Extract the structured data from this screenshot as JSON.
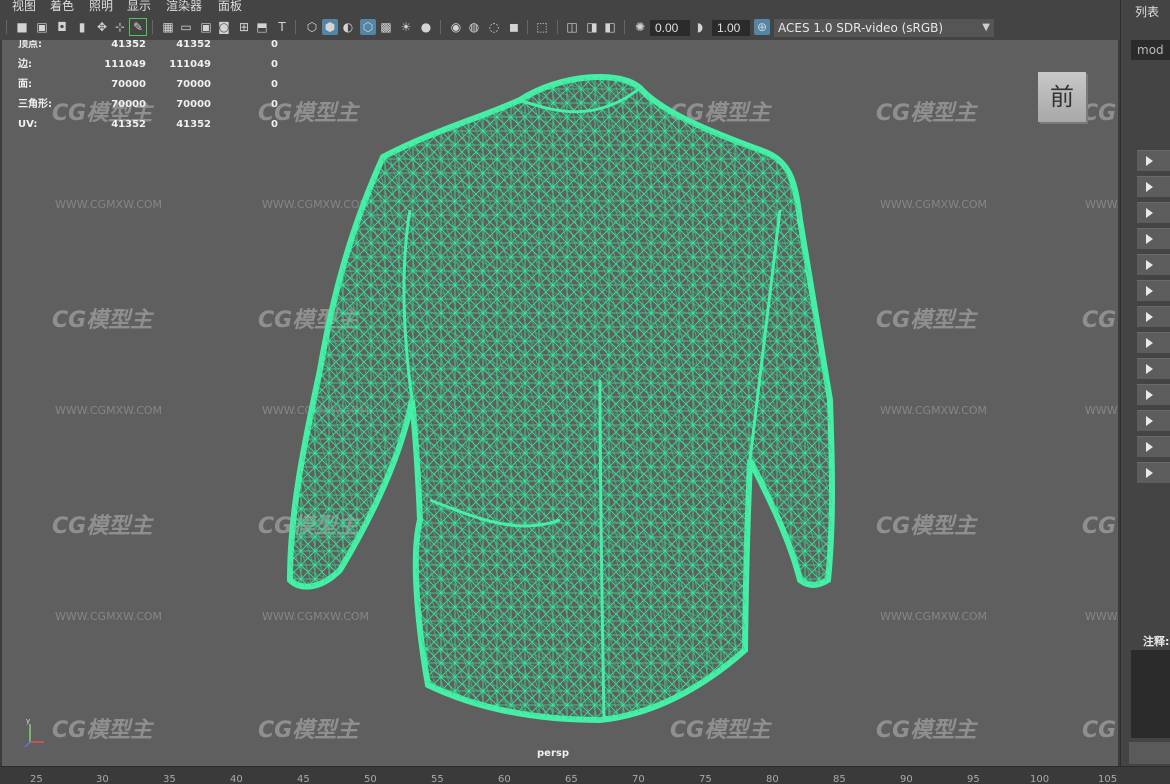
{
  "menu": {
    "items": [
      "视图",
      "着色",
      "照明",
      "显示",
      "渲染器",
      "面板"
    ]
  },
  "toolbar": {
    "icons": [
      "camera-icon",
      "camera-attr-icon",
      "bookmark-icon",
      "image-plane-icon",
      "grid-icon",
      "film-gate-icon",
      "resolution-gate-icon",
      "gate-mask-icon",
      "field-chart-icon",
      "safe-action-icon",
      "safe-title-icon",
      "wireframe-icon",
      "smooth-shade-icon",
      "default-material-icon",
      "xray-icon",
      "texture-icon",
      "lights-icon",
      "shadows-icon",
      "ambient-occlusion-icon",
      "motion-blur-icon",
      "antialias-icon",
      "depth-of-field-icon",
      "isolate-icon",
      "xray-joints-icon",
      "xray-active-icon",
      "backface-icon",
      "exposure-icon",
      "gamma-icon",
      "colormanage-icon"
    ],
    "exposure_value": "0.00",
    "gamma_value": "1.00",
    "color_space": "ACES 1.0 SDR-video (sRGB)"
  },
  "hud": {
    "rows": [
      {
        "label": "顶点:",
        "a": "41352",
        "b": "41352",
        "c": "0"
      },
      {
        "label": "边:",
        "a": "111049",
        "b": "111049",
        "c": "0"
      },
      {
        "label": "面:",
        "a": "70000",
        "b": "70000",
        "c": "0"
      },
      {
        "label": "三角形:",
        "a": "70000",
        "b": "70000",
        "c": "0"
      },
      {
        "label": "UV:",
        "a": "41352",
        "b": "41352",
        "c": "0"
      }
    ]
  },
  "viewport": {
    "camera_label": "persp",
    "viewcube_label": "前",
    "watermark_logo": "CG模型主",
    "watermark_url": "WWW.CGMXW.COM",
    "wire_color": "#3df2a0"
  },
  "timeline": {
    "ticks": [
      "25",
      "30",
      "35",
      "40",
      "45",
      "50",
      "55",
      "60",
      "65",
      "70",
      "75",
      "80",
      "85",
      "90",
      "95",
      "100",
      "105"
    ]
  },
  "right_panel": {
    "list_label": "列表",
    "search_text": "mod",
    "expander_count": 13,
    "notes_label": "注释:"
  }
}
